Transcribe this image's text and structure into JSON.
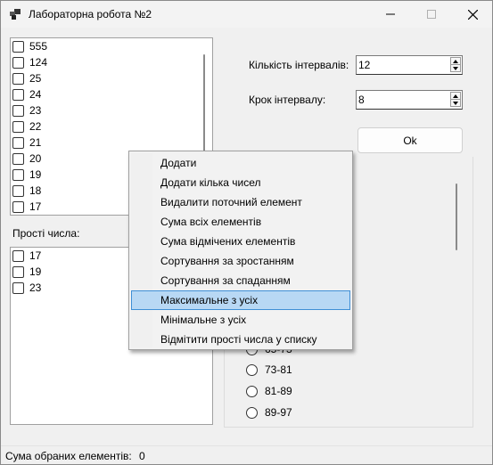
{
  "window": {
    "title": "Лабораторна робота №2",
    "icon": "app-window-icon"
  },
  "numbers_list": {
    "items": [
      "555",
      "124",
      "25",
      "24",
      "23",
      "22",
      "21",
      "20",
      "19",
      "18",
      "17"
    ]
  },
  "primes": {
    "label": "Прості числа:",
    "items": [
      "17",
      "19",
      "23"
    ]
  },
  "intervals": {
    "count_label": "Кількість інтервалів:",
    "count_value": "12",
    "step_label": "Крок інтервалу:",
    "step_value": "8",
    "ok_label": "Ok"
  },
  "ranges": {
    "partial_item": "65-73",
    "items": [
      "73-81",
      "81-89",
      "89-97"
    ]
  },
  "context_menu": {
    "items": [
      "Додати",
      "Додати кілька чисел",
      "Видалити поточний елемент",
      "Сума всіх елементів",
      "Сума відмічених елементів",
      "Сортування за зростанням",
      "Сортування за спаданням",
      "Максимальне з усіх",
      "Мінімальне з усіх",
      "Відмітити прості числа у списку"
    ],
    "highlighted": "Максимальне з усіх"
  },
  "status": {
    "label": "Сума обраних елементів:",
    "value": "0"
  },
  "colors": {
    "menu_highlight": "#b8d8f4",
    "menu_highlight_border": "#3f8fd6"
  }
}
